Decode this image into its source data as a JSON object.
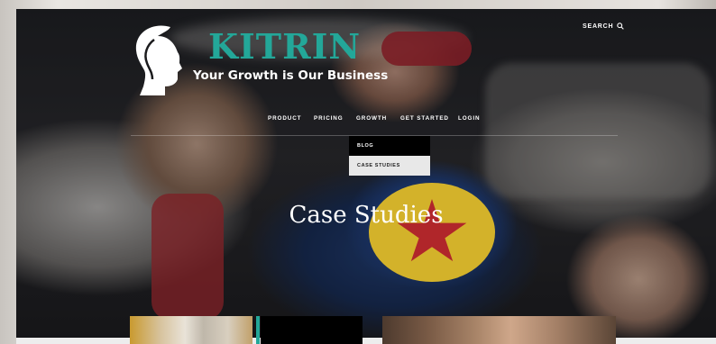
{
  "brand": {
    "name": "KITRIN",
    "tagline": "Your Growth is Our Business",
    "colors": {
      "accent": "#23a799",
      "text": "#ffffff"
    }
  },
  "header": {
    "search_label": "SEARCH",
    "search_icon": "search-icon"
  },
  "nav": {
    "items": [
      {
        "label": "PRODUCT"
      },
      {
        "label": "PRICING"
      },
      {
        "label": "GROWTH"
      },
      {
        "label": "GET STARTED"
      },
      {
        "label": "LOGIN"
      }
    ]
  },
  "dropdown": {
    "items": [
      {
        "label": "BLOG"
      },
      {
        "label": "CASE STUDIES"
      }
    ]
  },
  "hero": {
    "title": "Case Studies"
  }
}
